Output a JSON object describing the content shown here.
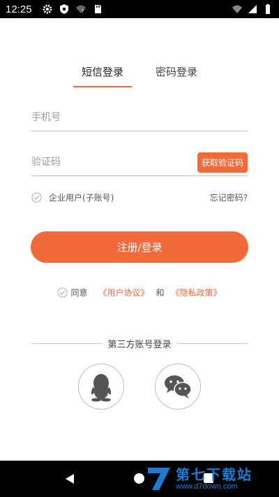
{
  "status_bar": {
    "time": "12:25",
    "left_icons": [
      "gear-icon",
      "shield-icon",
      "wifi-question-icon",
      "sd-card-icon"
    ],
    "right_icons": [
      "wifi-icon",
      "signal-icon",
      "battery-icon"
    ]
  },
  "tabs": [
    {
      "label": "短信登录",
      "active": true
    },
    {
      "label": "密码登录",
      "active": false
    }
  ],
  "form": {
    "phone_placeholder": "手机号",
    "code_placeholder": "验证码",
    "get_code_label": "获取验证码",
    "enterprise_label": "企业用户(子账号)",
    "forgot_label": "忘记密码?",
    "submit_label": "注册/登录"
  },
  "agreement": {
    "agree_text": "同意",
    "user_agreement": "《用户协议》",
    "and_text": "和",
    "privacy_policy": "《隐私政策》"
  },
  "third_party": {
    "title": "第三方账号登录",
    "providers": [
      "qq-icon",
      "wechat-icon"
    ]
  },
  "watermark": {
    "title": "第七下载站",
    "url": "www.d7down.com"
  },
  "colors": {
    "accent": "#f06a3a",
    "watermark_blue": "#1a7cd8"
  }
}
